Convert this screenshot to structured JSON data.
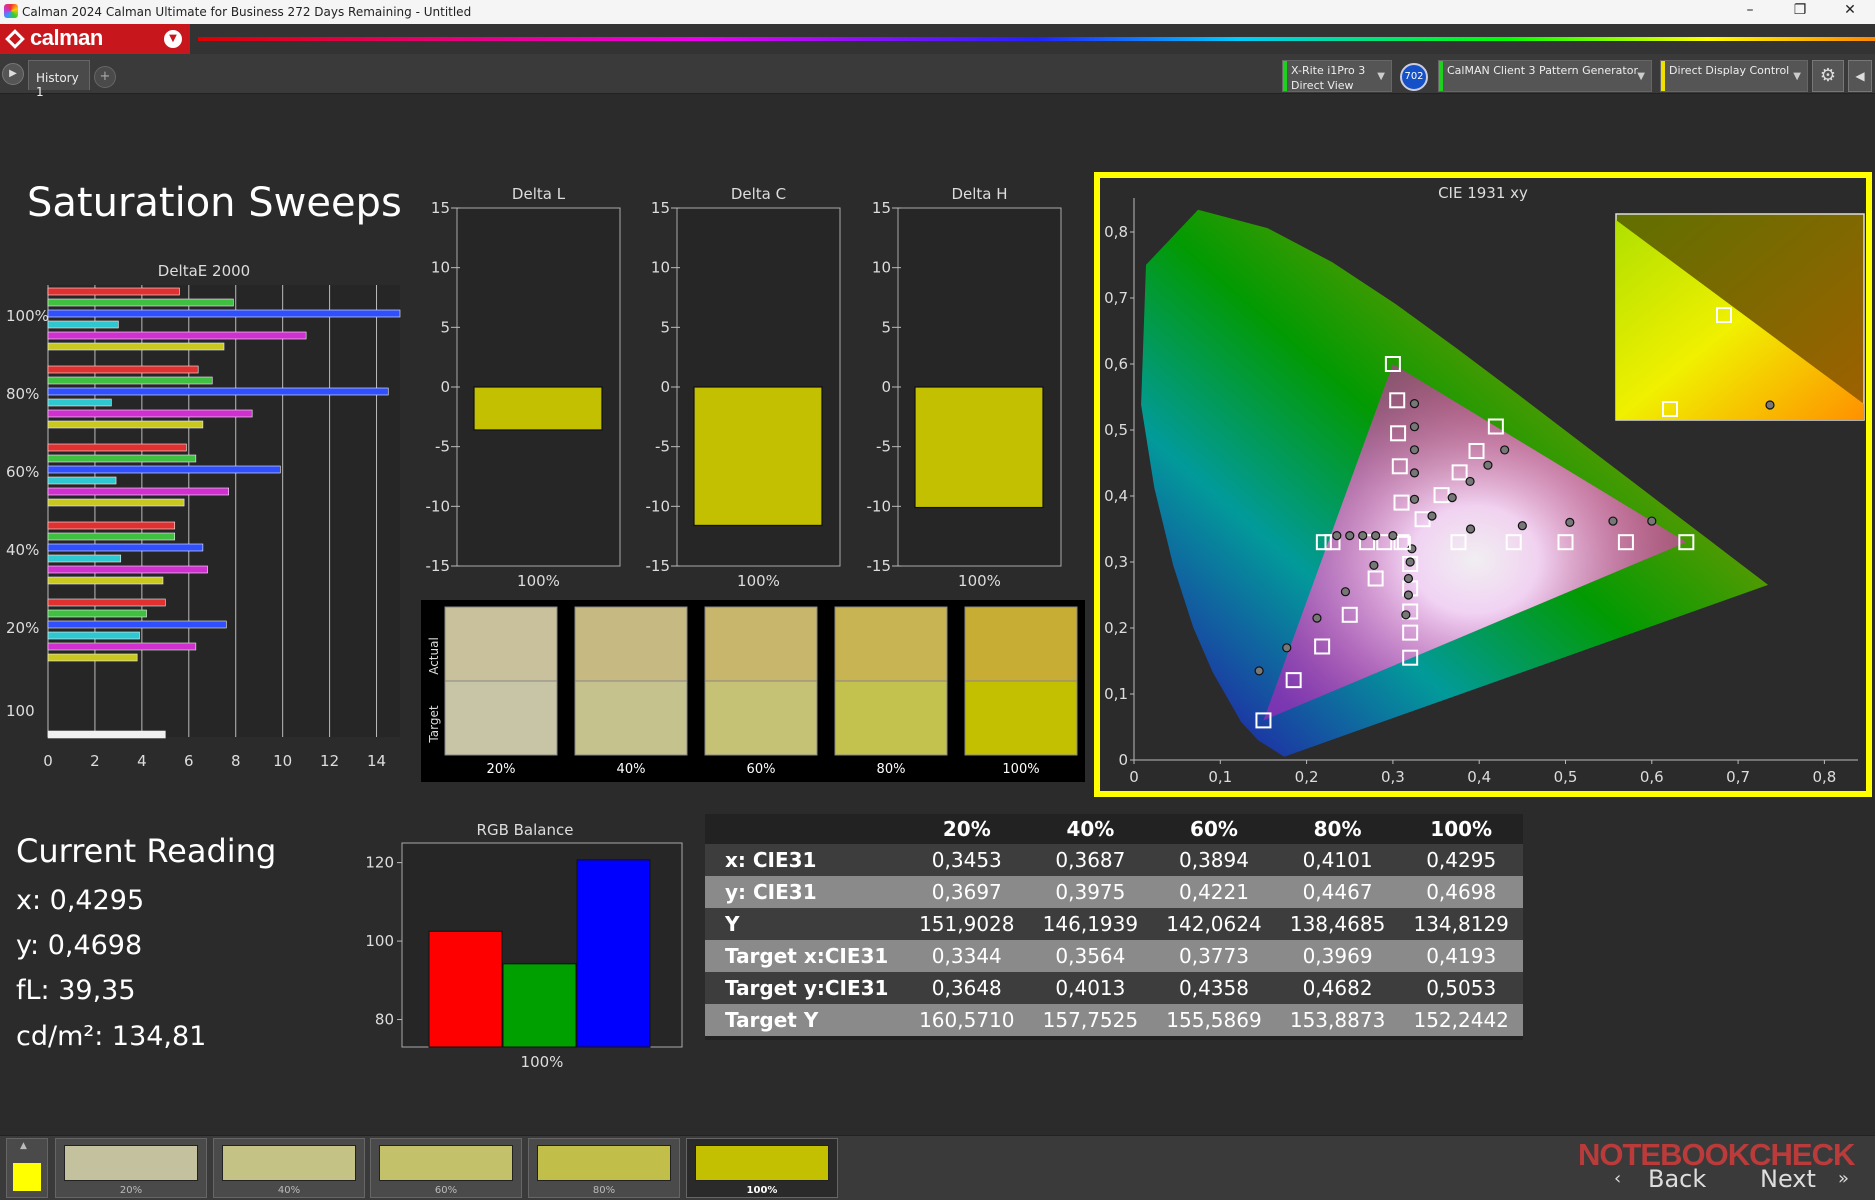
{
  "window": {
    "title": "Calman 2024 Calman Ultimate for Business 272 Days Remaining  - Untitled",
    "min": "–",
    "max": "❐",
    "close": "✕"
  },
  "brand": {
    "logo": "calman"
  },
  "tabs": [
    {
      "label": "History 1"
    }
  ],
  "toolbar": {
    "play": "▶",
    "add": "+",
    "meter_line1": "X-Rite i1Pro 3",
    "meter_line2": "Direct View",
    "meter_badge": "702",
    "generator": "CalMAN Client 3 Pattern Generator",
    "display": "Direct Display Control",
    "settings_icon": "gear-icon",
    "collapse_icon": "chevron-left-icon"
  },
  "page": {
    "title": "Saturation Sweeps"
  },
  "deltae_chart": {
    "title": "DeltaE 2000",
    "group_labels": [
      "100%",
      "80%",
      "60%",
      "40%",
      "20%",
      "100"
    ],
    "x_ticks": [
      "0",
      "2",
      "4",
      "6",
      "8",
      "10",
      "12",
      "14"
    ]
  },
  "delta_charts": [
    {
      "title": "Delta L",
      "xlabel": "100%",
      "value": -3.6,
      "y_ticks": [
        "15",
        "10",
        "5",
        "0",
        "-5",
        "-10",
        "-15"
      ]
    },
    {
      "title": "Delta C",
      "xlabel": "100%",
      "value": -11.6,
      "y_ticks": [
        "15",
        "10",
        "5",
        "0",
        "-5",
        "-10",
        "-15"
      ]
    },
    {
      "title": "Delta H",
      "xlabel": "100%",
      "value": -10.1,
      "y_ticks": [
        "15",
        "10",
        "5",
        "0",
        "-5",
        "-10",
        "-15"
      ]
    }
  ],
  "swatches": {
    "row_labels": [
      "Actual",
      "Target"
    ],
    "items": [
      {
        "label": "20%",
        "actual": "#c9c19c",
        "target": "#c7c5a6"
      },
      {
        "label": "40%",
        "actual": "#c7b982",
        "target": "#c5c28e"
      },
      {
        "label": "60%",
        "actual": "#c8b66c",
        "target": "#c5c276"
      },
      {
        "label": "80%",
        "actual": "#c8b452",
        "target": "#c3c24e"
      },
      {
        "label": "100%",
        "actual": "#c8ad34",
        "target": "#c2c000"
      }
    ]
  },
  "cie_chart": {
    "title": "CIE 1931 xy",
    "x_ticks": [
      "0",
      "0,1",
      "0,2",
      "0,3",
      "0,4",
      "0,5",
      "0,6",
      "0,7",
      "0,8"
    ],
    "y_ticks": [
      "0",
      "0,1",
      "0,2",
      "0,3",
      "0,4",
      "0,5",
      "0,6",
      "0,7",
      "0,8"
    ]
  },
  "current_reading": {
    "title": "Current Reading",
    "x": "x: 0,4295",
    "y": "y: 0,4698",
    "fl": "fL: 39,35",
    "cdm2": "cd/m²: 134,81"
  },
  "rgb_balance": {
    "title": "RGB Balance",
    "xlabel": "100%",
    "y_ticks": [
      "120",
      "100",
      "80"
    ]
  },
  "table": {
    "columns": [
      "20%",
      "40%",
      "60%",
      "80%",
      "100%"
    ],
    "rows": [
      {
        "label": "x: CIE31",
        "values": [
          "0,3453",
          "0,3687",
          "0,3894",
          "0,4101",
          "0,4295"
        ]
      },
      {
        "label": "y: CIE31",
        "values": [
          "0,3697",
          "0,3975",
          "0,4221",
          "0,4467",
          "0,4698"
        ]
      },
      {
        "label": "Y",
        "values": [
          "151,9028",
          "146,1939",
          "142,0624",
          "138,4685",
          "134,8129"
        ]
      },
      {
        "label": "Target x:CIE31",
        "values": [
          "0,3344",
          "0,3564",
          "0,3773",
          "0,3969",
          "0,4193"
        ]
      },
      {
        "label": "Target y:CIE31",
        "values": [
          "0,3648",
          "0,4013",
          "0,4358",
          "0,4682",
          "0,5053"
        ]
      },
      {
        "label": "Target Y",
        "values": [
          "160,5710",
          "157,7525",
          "155,5869",
          "153,8873",
          "152,2442"
        ]
      }
    ]
  },
  "bottom": {
    "patches": [
      {
        "label": "20%",
        "color": "#c3c19e"
      },
      {
        "label": "40%",
        "color": "#c4c284"
      },
      {
        "label": "60%",
        "color": "#c4c16b"
      },
      {
        "label": "80%",
        "color": "#c1bf4a"
      },
      {
        "label": "100%",
        "color": "#c2c000"
      }
    ],
    "back": "Back",
    "next": "Next",
    "watermark": "NOTEBOOKCHECK"
  },
  "chart_data": [
    {
      "type": "bar",
      "title": "DeltaE 2000",
      "orientation": "horizontal",
      "xlim": [
        0,
        15
      ],
      "groups": [
        "100%",
        "80%",
        "60%",
        "40%",
        "20%",
        "100"
      ],
      "series": [
        {
          "color": "#e03030",
          "values": [
            5.6,
            6.4,
            5.9,
            5.4,
            5.0,
            null
          ]
        },
        {
          "color": "#40c040",
          "values": [
            7.9,
            7.0,
            6.3,
            5.4,
            4.2,
            null
          ]
        },
        {
          "color": "#3050ff",
          "values": [
            15.0,
            14.5,
            9.9,
            6.6,
            7.6,
            null
          ]
        },
        {
          "color": "#30c8d0",
          "values": [
            3.0,
            2.7,
            2.9,
            3.1,
            3.9,
            null
          ]
        },
        {
          "color": "#d030d0",
          "values": [
            11.0,
            8.7,
            7.7,
            6.8,
            6.3,
            null
          ]
        },
        {
          "color": "#c8c820",
          "values": [
            7.5,
            6.6,
            5.8,
            4.9,
            3.8,
            null
          ]
        },
        {
          "color": "#f0f0f0",
          "values": [
            null,
            null,
            null,
            null,
            null,
            5.0
          ]
        }
      ]
    },
    {
      "type": "bar",
      "title": "Delta L",
      "categories": [
        "100%"
      ],
      "values": [
        -3.6
      ],
      "ylim": [
        -15,
        15
      ]
    },
    {
      "type": "bar",
      "title": "Delta C",
      "categories": [
        "100%"
      ],
      "values": [
        -11.6
      ],
      "ylim": [
        -15,
        15
      ]
    },
    {
      "type": "bar",
      "title": "Delta H",
      "categories": [
        "100%"
      ],
      "values": [
        -10.1
      ],
      "ylim": [
        -15,
        15
      ]
    },
    {
      "type": "scatter",
      "title": "CIE 1931 xy",
      "xlim": [
        0,
        0.8
      ],
      "ylim": [
        0,
        0.8
      ],
      "gamut_triangle": [
        [
          0.64,
          0.33
        ],
        [
          0.3,
          0.6
        ],
        [
          0.15,
          0.06
        ]
      ],
      "white_point": [
        0.3127,
        0.329
      ],
      "targets": [
        [
          0.3344,
          0.3648
        ],
        [
          0.3564,
          0.4013
        ],
        [
          0.3773,
          0.4358
        ],
        [
          0.3969,
          0.4682
        ],
        [
          0.4193,
          0.5053
        ],
        [
          0.376,
          0.33
        ],
        [
          0.44,
          0.33
        ],
        [
          0.5,
          0.33
        ],
        [
          0.57,
          0.33
        ],
        [
          0.64,
          0.33
        ],
        [
          0.3,
          0.6
        ],
        [
          0.305,
          0.545
        ],
        [
          0.306,
          0.495
        ],
        [
          0.308,
          0.445
        ],
        [
          0.31,
          0.39
        ],
        [
          0.15,
          0.06
        ],
        [
          0.185,
          0.121
        ],
        [
          0.218,
          0.172
        ],
        [
          0.25,
          0.22
        ],
        [
          0.28,
          0.275
        ],
        [
          0.22,
          0.33
        ],
        [
          0.23,
          0.33
        ],
        [
          0.27,
          0.33
        ],
        [
          0.29,
          0.33
        ],
        [
          0.31,
          0.33
        ],
        [
          0.32,
          0.155
        ],
        [
          0.32,
          0.193
        ],
        [
          0.32,
          0.225
        ],
        [
          0.32,
          0.26
        ],
        [
          0.32,
          0.297
        ]
      ],
      "measured": [
        [
          0.3453,
          0.3697
        ],
        [
          0.3687,
          0.3975
        ],
        [
          0.3894,
          0.4221
        ],
        [
          0.4101,
          0.4467
        ],
        [
          0.4295,
          0.4698
        ],
        [
          0.39,
          0.35
        ],
        [
          0.45,
          0.355
        ],
        [
          0.505,
          0.36
        ],
        [
          0.555,
          0.362
        ],
        [
          0.6,
          0.362
        ],
        [
          0.325,
          0.54
        ],
        [
          0.325,
          0.505
        ],
        [
          0.325,
          0.47
        ],
        [
          0.325,
          0.435
        ],
        [
          0.325,
          0.395
        ],
        [
          0.145,
          0.135
        ],
        [
          0.177,
          0.17
        ],
        [
          0.212,
          0.215
        ],
        [
          0.245,
          0.255
        ],
        [
          0.278,
          0.295
        ],
        [
          0.235,
          0.34
        ],
        [
          0.25,
          0.34
        ],
        [
          0.265,
          0.34
        ],
        [
          0.28,
          0.34
        ],
        [
          0.3,
          0.34
        ],
        [
          0.315,
          0.22
        ],
        [
          0.318,
          0.25
        ],
        [
          0.318,
          0.275
        ],
        [
          0.32,
          0.3
        ],
        [
          0.322,
          0.32
        ]
      ]
    },
    {
      "type": "bar",
      "title": "RGB Balance",
      "categories": [
        "100%"
      ],
      "series": [
        {
          "color": "#ff0000",
          "values": [
            102.5
          ]
        },
        {
          "color": "#00a000",
          "values": [
            94.2
          ]
        },
        {
          "color": "#0000ff",
          "values": [
            120.7
          ]
        }
      ],
      "ylim": [
        73,
        125
      ]
    }
  ]
}
